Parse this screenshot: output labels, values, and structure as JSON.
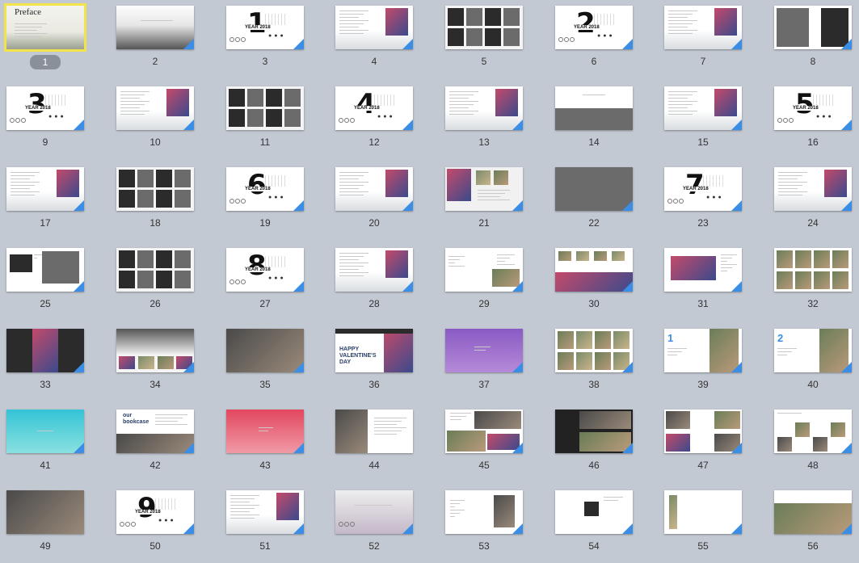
{
  "slides": [
    {
      "n": "1",
      "kind": "preface",
      "text": "Preface",
      "selected": true
    },
    {
      "n": "2",
      "kind": "mist",
      "text": "",
      "selected": false
    },
    {
      "n": "3",
      "kind": "chapter",
      "text": "1",
      "selected": false
    },
    {
      "n": "4",
      "kind": "textphoto",
      "text": "",
      "selected": false
    },
    {
      "n": "5",
      "kind": "bwgrid",
      "text": "",
      "selected": false
    },
    {
      "n": "6",
      "kind": "chapter",
      "text": "2",
      "selected": false
    },
    {
      "n": "7",
      "kind": "textphoto",
      "text": "",
      "selected": false
    },
    {
      "n": "8",
      "kind": "bwtwo",
      "text": "",
      "selected": false
    },
    {
      "n": "9",
      "kind": "chapter",
      "text": "3",
      "selected": false
    },
    {
      "n": "10",
      "kind": "textphoto",
      "text": "",
      "selected": false
    },
    {
      "n": "11",
      "kind": "bwgrid",
      "text": "",
      "selected": false
    },
    {
      "n": "12",
      "kind": "chapter",
      "text": "4",
      "selected": false
    },
    {
      "n": "13",
      "kind": "textphoto",
      "text": "",
      "selected": false
    },
    {
      "n": "14",
      "kind": "caption",
      "text": "",
      "selected": false
    },
    {
      "n": "15",
      "kind": "textphoto",
      "text": "",
      "selected": false
    },
    {
      "n": "16",
      "kind": "chapter",
      "text": "5",
      "selected": false
    },
    {
      "n": "17",
      "kind": "textphoto",
      "text": "",
      "selected": false
    },
    {
      "n": "18",
      "kind": "bwgrid",
      "text": "",
      "selected": false
    },
    {
      "n": "19",
      "kind": "chapter",
      "text": "6",
      "selected": false
    },
    {
      "n": "20",
      "kind": "textphoto",
      "text": "",
      "selected": false
    },
    {
      "n": "21",
      "kind": "collage",
      "text": "",
      "selected": false
    },
    {
      "n": "22",
      "kind": "bwfull",
      "text": "",
      "selected": false
    },
    {
      "n": "23",
      "kind": "chapter",
      "text": "7",
      "selected": false
    },
    {
      "n": "24",
      "kind": "textphoto",
      "text": "",
      "selected": false
    },
    {
      "n": "25",
      "kind": "twoframes",
      "text": "",
      "selected": false
    },
    {
      "n": "26",
      "kind": "bwgrid",
      "text": "",
      "selected": false
    },
    {
      "n": "27",
      "kind": "chapter",
      "text": "8",
      "selected": false
    },
    {
      "n": "28",
      "kind": "textphoto",
      "text": "",
      "selected": false
    },
    {
      "n": "29",
      "kind": "about",
      "text": "",
      "selected": false
    },
    {
      "n": "30",
      "kind": "landscape",
      "text": "",
      "selected": false
    },
    {
      "n": "31",
      "kind": "redphoto",
      "text": "",
      "selected": false
    },
    {
      "n": "32",
      "kind": "food",
      "text": "",
      "selected": false
    },
    {
      "n": "33",
      "kind": "darkcolor",
      "text": "",
      "selected": false
    },
    {
      "n": "34",
      "kind": "cloudcards",
      "text": "",
      "selected": false
    },
    {
      "n": "35",
      "kind": "groupdark",
      "text": "",
      "selected": false
    },
    {
      "n": "36",
      "kind": "valentine",
      "text": "HAPPY VALENTINE'S DAY",
      "selected": false
    },
    {
      "n": "37",
      "kind": "purple",
      "text": "",
      "selected": false
    },
    {
      "n": "38",
      "kind": "people",
      "text": "",
      "selected": false
    },
    {
      "n": "39",
      "kind": "profile",
      "text": "1",
      "selected": false
    },
    {
      "n": "40",
      "kind": "profile",
      "text": "2",
      "selected": false
    },
    {
      "n": "41",
      "kind": "teal",
      "text": "",
      "selected": false
    },
    {
      "n": "42",
      "kind": "bookcase",
      "text": "our bookcase",
      "selected": false
    },
    {
      "n": "43",
      "kind": "coral",
      "text": "",
      "selected": false
    },
    {
      "n": "44",
      "kind": "portrait",
      "text": "",
      "selected": false
    },
    {
      "n": "45",
      "kind": "event",
      "text": "",
      "selected": false
    },
    {
      "n": "46",
      "kind": "darkevent",
      "text": "",
      "selected": false
    },
    {
      "n": "47",
      "kind": "numbered",
      "text": "",
      "selected": false
    },
    {
      "n": "48",
      "kind": "outstanding",
      "text": "",
      "selected": false
    },
    {
      "n": "49",
      "kind": "crowd",
      "text": "",
      "selected": false
    },
    {
      "n": "50",
      "kind": "chapter",
      "text": "9",
      "selected": false
    },
    {
      "n": "51",
      "kind": "textphoto",
      "text": "",
      "selected": false
    },
    {
      "n": "52",
      "kind": "calligraphy",
      "text": "",
      "selected": false
    },
    {
      "n": "53",
      "kind": "moon",
      "text": "",
      "selected": false
    },
    {
      "n": "54",
      "kind": "seal",
      "text": "",
      "selected": false
    },
    {
      "n": "55",
      "kind": "scroll",
      "text": "",
      "selected": false
    },
    {
      "n": "56",
      "kind": "ending",
      "text": "",
      "selected": false
    }
  ],
  "colors": {
    "background": "#c3c9d2",
    "selection": "#f2e34a",
    "badge": "#8a9099",
    "accent": "#3a8ee6"
  }
}
